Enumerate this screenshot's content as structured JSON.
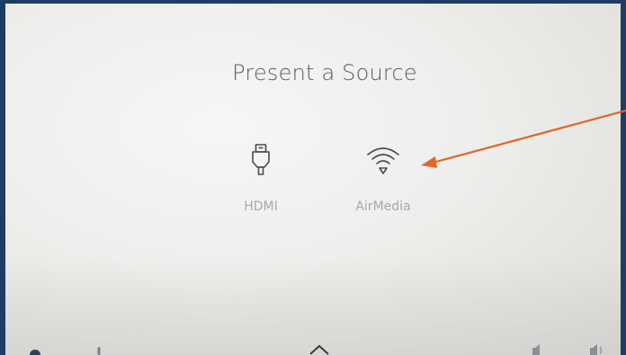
{
  "page": {
    "title": "Present a Source"
  },
  "sources": [
    {
      "label": "HDMI",
      "icon": "hdmi-plug-icon"
    },
    {
      "label": "AirMedia",
      "icon": "wifi-icon"
    }
  ],
  "bottom_bar": {
    "icons": [
      "info-icon",
      "microphone-icon",
      "chevron-up-icon",
      "volume-down-icon",
      "volume-up-icon"
    ]
  },
  "annotation": {
    "arrow_color": "#e0672a"
  },
  "colors": {
    "bezel": "#1f3d63",
    "title": "#5b5b5b",
    "label": "#a9a9a9",
    "icon": "#4a4a4a"
  }
}
